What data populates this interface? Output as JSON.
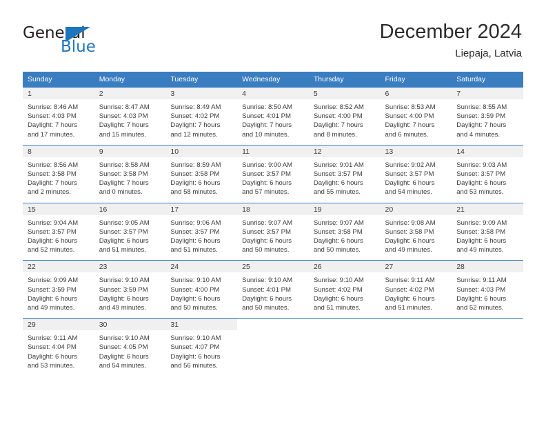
{
  "logo": {
    "text_primary": "General",
    "text_secondary": "Blue",
    "icon": "triangle-flag-icon",
    "color_primary": "#231f20",
    "color_secondary": "#1d75bd"
  },
  "header": {
    "title": "December 2024",
    "subtitle": "Liepaja, Latvia"
  },
  "theme": {
    "header_blue": "#3a7dc0",
    "band_gray": "#f0f0f0",
    "text": "#3b3b3b"
  },
  "calendar": {
    "weekday_headers": [
      "Sunday",
      "Monday",
      "Tuesday",
      "Wednesday",
      "Thursday",
      "Friday",
      "Saturday"
    ],
    "weeks": [
      [
        {
          "day": "1",
          "sunrise": "Sunrise: 8:46 AM",
          "sunset": "Sunset: 4:03 PM",
          "daylight1": "Daylight: 7 hours",
          "daylight2": "and 17 minutes."
        },
        {
          "day": "2",
          "sunrise": "Sunrise: 8:47 AM",
          "sunset": "Sunset: 4:03 PM",
          "daylight1": "Daylight: 7 hours",
          "daylight2": "and 15 minutes."
        },
        {
          "day": "3",
          "sunrise": "Sunrise: 8:49 AM",
          "sunset": "Sunset: 4:02 PM",
          "daylight1": "Daylight: 7 hours",
          "daylight2": "and 12 minutes."
        },
        {
          "day": "4",
          "sunrise": "Sunrise: 8:50 AM",
          "sunset": "Sunset: 4:01 PM",
          "daylight1": "Daylight: 7 hours",
          "daylight2": "and 10 minutes."
        },
        {
          "day": "5",
          "sunrise": "Sunrise: 8:52 AM",
          "sunset": "Sunset: 4:00 PM",
          "daylight1": "Daylight: 7 hours",
          "daylight2": "and 8 minutes."
        },
        {
          "day": "6",
          "sunrise": "Sunrise: 8:53 AM",
          "sunset": "Sunset: 4:00 PM",
          "daylight1": "Daylight: 7 hours",
          "daylight2": "and 6 minutes."
        },
        {
          "day": "7",
          "sunrise": "Sunrise: 8:55 AM",
          "sunset": "Sunset: 3:59 PM",
          "daylight1": "Daylight: 7 hours",
          "daylight2": "and 4 minutes."
        }
      ],
      [
        {
          "day": "8",
          "sunrise": "Sunrise: 8:56 AM",
          "sunset": "Sunset: 3:58 PM",
          "daylight1": "Daylight: 7 hours",
          "daylight2": "and 2 minutes."
        },
        {
          "day": "9",
          "sunrise": "Sunrise: 8:58 AM",
          "sunset": "Sunset: 3:58 PM",
          "daylight1": "Daylight: 7 hours",
          "daylight2": "and 0 minutes."
        },
        {
          "day": "10",
          "sunrise": "Sunrise: 8:59 AM",
          "sunset": "Sunset: 3:58 PM",
          "daylight1": "Daylight: 6 hours",
          "daylight2": "and 58 minutes."
        },
        {
          "day": "11",
          "sunrise": "Sunrise: 9:00 AM",
          "sunset": "Sunset: 3:57 PM",
          "daylight1": "Daylight: 6 hours",
          "daylight2": "and 57 minutes."
        },
        {
          "day": "12",
          "sunrise": "Sunrise: 9:01 AM",
          "sunset": "Sunset: 3:57 PM",
          "daylight1": "Daylight: 6 hours",
          "daylight2": "and 55 minutes."
        },
        {
          "day": "13",
          "sunrise": "Sunrise: 9:02 AM",
          "sunset": "Sunset: 3:57 PM",
          "daylight1": "Daylight: 6 hours",
          "daylight2": "and 54 minutes."
        },
        {
          "day": "14",
          "sunrise": "Sunrise: 9:03 AM",
          "sunset": "Sunset: 3:57 PM",
          "daylight1": "Daylight: 6 hours",
          "daylight2": "and 53 minutes."
        }
      ],
      [
        {
          "day": "15",
          "sunrise": "Sunrise: 9:04 AM",
          "sunset": "Sunset: 3:57 PM",
          "daylight1": "Daylight: 6 hours",
          "daylight2": "and 52 minutes."
        },
        {
          "day": "16",
          "sunrise": "Sunrise: 9:05 AM",
          "sunset": "Sunset: 3:57 PM",
          "daylight1": "Daylight: 6 hours",
          "daylight2": "and 51 minutes."
        },
        {
          "day": "17",
          "sunrise": "Sunrise: 9:06 AM",
          "sunset": "Sunset: 3:57 PM",
          "daylight1": "Daylight: 6 hours",
          "daylight2": "and 51 minutes."
        },
        {
          "day": "18",
          "sunrise": "Sunrise: 9:07 AM",
          "sunset": "Sunset: 3:57 PM",
          "daylight1": "Daylight: 6 hours",
          "daylight2": "and 50 minutes."
        },
        {
          "day": "19",
          "sunrise": "Sunrise: 9:07 AM",
          "sunset": "Sunset: 3:58 PM",
          "daylight1": "Daylight: 6 hours",
          "daylight2": "and 50 minutes."
        },
        {
          "day": "20",
          "sunrise": "Sunrise: 9:08 AM",
          "sunset": "Sunset: 3:58 PM",
          "daylight1": "Daylight: 6 hours",
          "daylight2": "and 49 minutes."
        },
        {
          "day": "21",
          "sunrise": "Sunrise: 9:09 AM",
          "sunset": "Sunset: 3:58 PM",
          "daylight1": "Daylight: 6 hours",
          "daylight2": "and 49 minutes."
        }
      ],
      [
        {
          "day": "22",
          "sunrise": "Sunrise: 9:09 AM",
          "sunset": "Sunset: 3:59 PM",
          "daylight1": "Daylight: 6 hours",
          "daylight2": "and 49 minutes."
        },
        {
          "day": "23",
          "sunrise": "Sunrise: 9:10 AM",
          "sunset": "Sunset: 3:59 PM",
          "daylight1": "Daylight: 6 hours",
          "daylight2": "and 49 minutes."
        },
        {
          "day": "24",
          "sunrise": "Sunrise: 9:10 AM",
          "sunset": "Sunset: 4:00 PM",
          "daylight1": "Daylight: 6 hours",
          "daylight2": "and 50 minutes."
        },
        {
          "day": "25",
          "sunrise": "Sunrise: 9:10 AM",
          "sunset": "Sunset: 4:01 PM",
          "daylight1": "Daylight: 6 hours",
          "daylight2": "and 50 minutes."
        },
        {
          "day": "26",
          "sunrise": "Sunrise: 9:10 AM",
          "sunset": "Sunset: 4:02 PM",
          "daylight1": "Daylight: 6 hours",
          "daylight2": "and 51 minutes."
        },
        {
          "day": "27",
          "sunrise": "Sunrise: 9:11 AM",
          "sunset": "Sunset: 4:02 PM",
          "daylight1": "Daylight: 6 hours",
          "daylight2": "and 51 minutes."
        },
        {
          "day": "28",
          "sunrise": "Sunrise: 9:11 AM",
          "sunset": "Sunset: 4:03 PM",
          "daylight1": "Daylight: 6 hours",
          "daylight2": "and 52 minutes."
        }
      ],
      [
        {
          "day": "29",
          "sunrise": "Sunrise: 9:11 AM",
          "sunset": "Sunset: 4:04 PM",
          "daylight1": "Daylight: 6 hours",
          "daylight2": "and 53 minutes."
        },
        {
          "day": "30",
          "sunrise": "Sunrise: 9:10 AM",
          "sunset": "Sunset: 4:05 PM",
          "daylight1": "Daylight: 6 hours",
          "daylight2": "and 54 minutes."
        },
        {
          "day": "31",
          "sunrise": "Sunrise: 9:10 AM",
          "sunset": "Sunset: 4:07 PM",
          "daylight1": "Daylight: 6 hours",
          "daylight2": "and 56 minutes."
        },
        {
          "day": "",
          "sunrise": "",
          "sunset": "",
          "daylight1": "",
          "daylight2": ""
        },
        {
          "day": "",
          "sunrise": "",
          "sunset": "",
          "daylight1": "",
          "daylight2": ""
        },
        {
          "day": "",
          "sunrise": "",
          "sunset": "",
          "daylight1": "",
          "daylight2": ""
        },
        {
          "day": "",
          "sunrise": "",
          "sunset": "",
          "daylight1": "",
          "daylight2": ""
        }
      ]
    ]
  }
}
